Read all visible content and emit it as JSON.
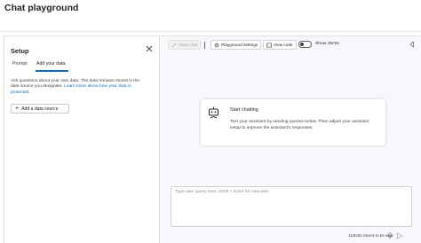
{
  "page": {
    "title": "Chat playground"
  },
  "setup": {
    "title": "Setup",
    "tabs": [
      {
        "label": "Prompt",
        "active": false
      },
      {
        "label": "Add your data",
        "active": true
      }
    ],
    "description": "Ask questions about your own data. The data remains stored in the data source you designate.",
    "link_text": "Learn more about how your data is protected.",
    "add_button_label": "Add a data source"
  },
  "toolbar": {
    "clear_chat": "Clear chat",
    "playground_settings": "Playground settings",
    "view_code": "View code",
    "show_json": "Show JSON",
    "show_json_on": false
  },
  "card": {
    "title": "Start chatting",
    "text": "Test your assistant by sending queries below. Then adjust your assistant setup to improve the assistant's responses."
  },
  "input": {
    "placeholder": "Type user query here. (Shift + Enter for new line)",
    "token_count": "11/8192 tokens to be sent"
  },
  "colors": {
    "accent": "#0f6cbd",
    "chat_bg": "#f6f8fc"
  }
}
